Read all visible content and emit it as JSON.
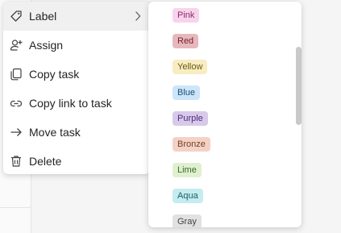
{
  "menu": {
    "items": [
      {
        "label": "Label",
        "icon": "tag-icon",
        "has_submenu": true
      },
      {
        "label": "Assign",
        "icon": "person-add-icon"
      },
      {
        "label": "Copy task",
        "icon": "copy-icon"
      },
      {
        "label": "Copy link to task",
        "icon": "link-icon"
      },
      {
        "label": "Move task",
        "icon": "arrow-right-icon"
      },
      {
        "label": "Delete",
        "icon": "trash-icon"
      }
    ]
  },
  "submenu": {
    "labels": [
      {
        "name": "Pink",
        "bg": "#f8d3ec",
        "fg": "#8a2a6a"
      },
      {
        "name": "Red",
        "bg": "#e6b8bd",
        "fg": "#7a1f2b"
      },
      {
        "name": "Yellow",
        "bg": "#f7ecc2",
        "fg": "#6b5a12"
      },
      {
        "name": "Blue",
        "bg": "#cde5f8",
        "fg": "#1b4f7a"
      },
      {
        "name": "Purple",
        "bg": "#d8c9ea",
        "fg": "#4d2d78"
      },
      {
        "name": "Bronze",
        "bg": "#f3d2c5",
        "fg": "#7b3b22"
      },
      {
        "name": "Lime",
        "bg": "#dff0d2",
        "fg": "#3b6a1d"
      },
      {
        "name": "Aqua",
        "bg": "#c5ecef",
        "fg": "#1b5f66"
      },
      {
        "name": "Gray",
        "bg": "#e1e1e1",
        "fg": "#424242"
      }
    ]
  },
  "colors": {
    "menu_bg": "#ffffff",
    "active_bg": "#f0f0f0",
    "text": "#242424",
    "scrollbar": "#c9c9c9"
  }
}
